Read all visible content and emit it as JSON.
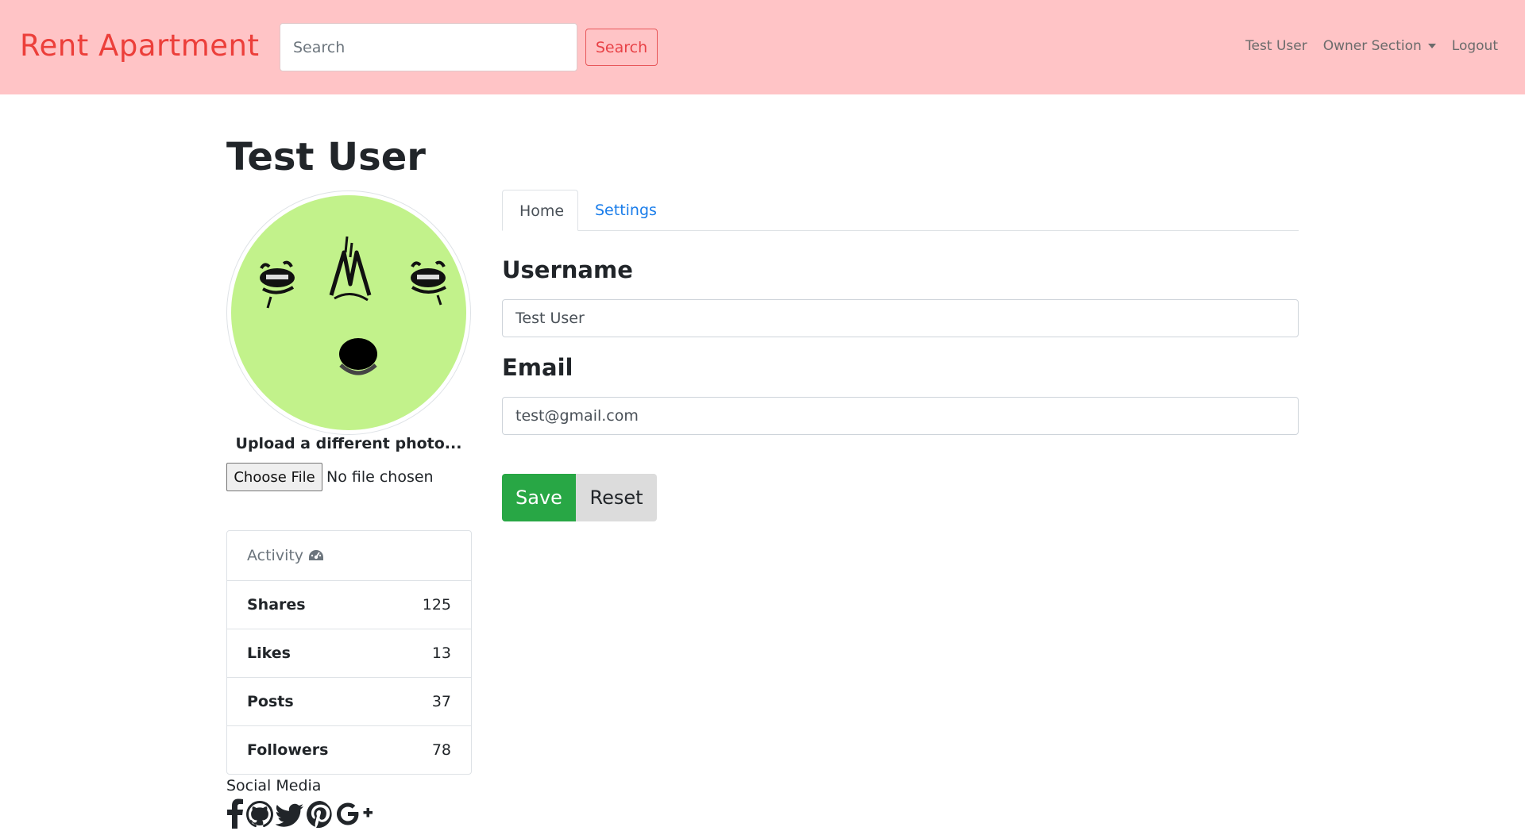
{
  "navbar": {
    "brand": "Rent Apartment",
    "search_placeholder": "Search",
    "search_button": "Search",
    "links": {
      "user": "Test User",
      "owner_section": "Owner Section",
      "logout": "Logout"
    }
  },
  "profile": {
    "title": "Test User",
    "upload_label": "Upload a different photo...",
    "file_button": "Choose File",
    "file_status": "No file chosen"
  },
  "activity": {
    "header": "Activity",
    "header_icon": "dashboard-icon",
    "items": [
      {
        "label": "Shares",
        "value": "125"
      },
      {
        "label": "Likes",
        "value": "13"
      },
      {
        "label": "Posts",
        "value": "37"
      },
      {
        "label": "Followers",
        "value": "78"
      }
    ]
  },
  "social": {
    "title": "Social Media",
    "icons": [
      "facebook-icon",
      "github-icon",
      "twitter-icon",
      "pinterest-icon",
      "google-plus-icon"
    ]
  },
  "tabs": {
    "home": "Home",
    "settings": "Settings"
  },
  "form": {
    "username_label": "Username",
    "username_value": "Test User",
    "email_label": "Email",
    "email_value": "test@gmail.com",
    "save_button": "Save",
    "reset_button": "Reset"
  },
  "colors": {
    "navbar_bg": "#ffc4c6",
    "brand": "#ec3f3a",
    "avatar_bg": "#c2f28b",
    "save": "#28a745",
    "tab_link": "#1a7dea"
  }
}
